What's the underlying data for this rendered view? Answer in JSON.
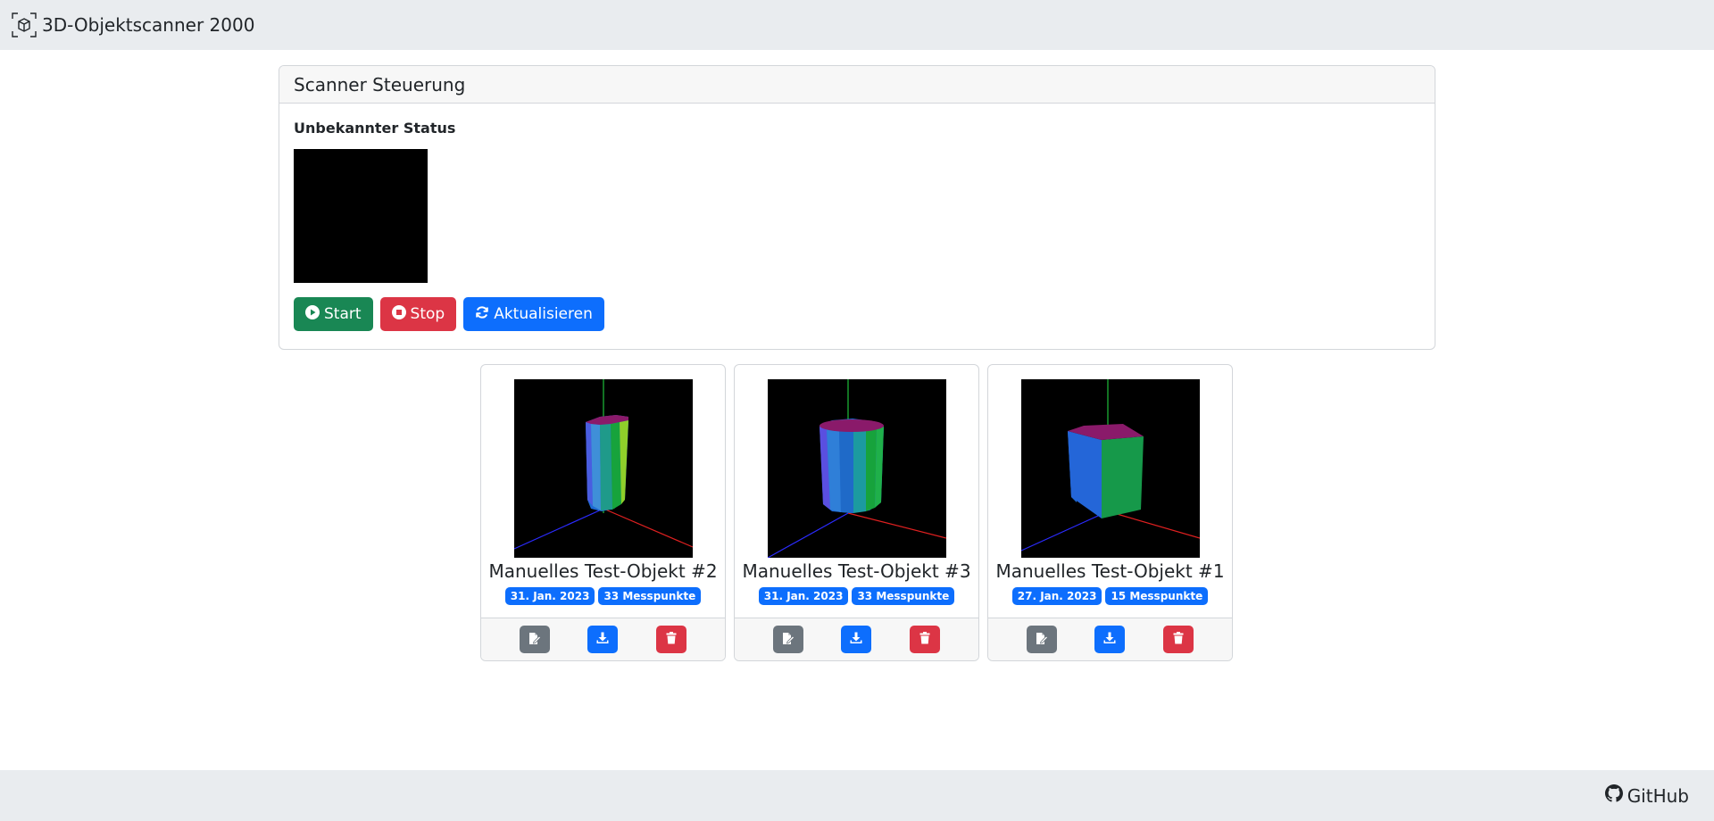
{
  "navbar": {
    "title": "3D-Objektscanner 2000",
    "logo_icon": "scanner-cube-icon"
  },
  "scanner": {
    "header": "Scanner Steuerung",
    "status": "Unbekannter Status",
    "buttons": {
      "start_label": "Start",
      "stop_label": "Stop",
      "refresh_label": "Aktualisieren"
    }
  },
  "objects": [
    {
      "title": "Manuelles Test-Objekt #2",
      "date": "31. Jan. 2023",
      "points": "33 Messpunkte",
      "shape": "cylinder-tilted"
    },
    {
      "title": "Manuelles Test-Objekt #3",
      "date": "31. Jan. 2023",
      "points": "33 Messpunkte",
      "shape": "cylinder"
    },
    {
      "title": "Manuelles Test-Objekt #1",
      "date": "27. Jan. 2023",
      "points": "15 Messpunkte",
      "shape": "box"
    }
  ],
  "footer": {
    "github_label": "GitHub",
    "github_icon": "github-icon"
  },
  "colors": {
    "navbar_bg": "#e9ecef",
    "success": "#198754",
    "danger": "#dc3545",
    "primary": "#0d6efd",
    "secondary": "#6c757d"
  }
}
